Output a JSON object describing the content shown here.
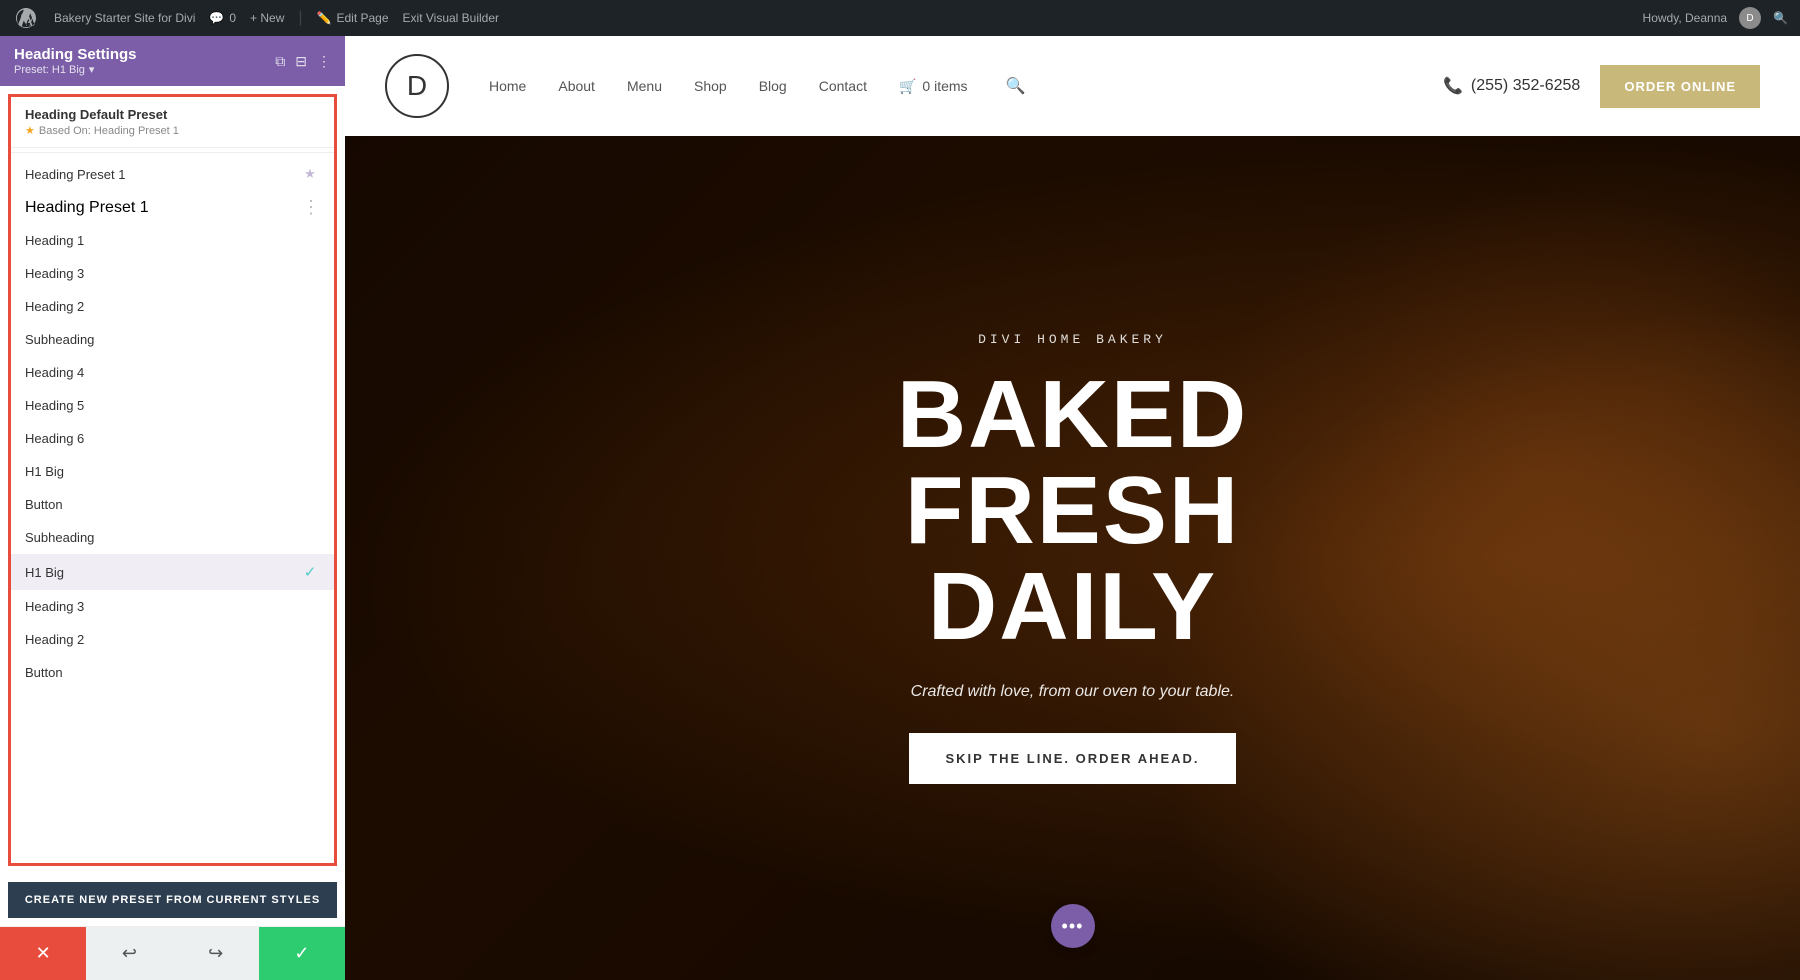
{
  "adminBar": {
    "wpLogoAlt": "WordPress",
    "siteName": "Bakery Starter Site for Divi",
    "commentCount": "0",
    "newLabel": "+ New",
    "editPageLabel": "Edit Page",
    "exitBuilderLabel": "Exit Visual Builder",
    "howdyText": "Howdy, Deanna",
    "searchIcon": "🔍"
  },
  "panelHeader": {
    "title": "Heading Settings",
    "preset": "Preset: H1 Big",
    "presetArrow": "▾",
    "duplicateIcon": "⧉",
    "splitIcon": "⊟",
    "moreIcon": "⋮"
  },
  "defaultPreset": {
    "name": "Heading Default Preset",
    "starIcon": "★",
    "basedOnLabel": "Based On: Heading Preset 1"
  },
  "presets": [
    {
      "label": "Heading Preset 1",
      "icon": "star",
      "active": false
    },
    {
      "label": "Heading Preset 1",
      "icon": "dots",
      "active": false
    },
    {
      "label": "Heading 1",
      "icon": "",
      "active": false
    },
    {
      "label": "Heading 3",
      "icon": "",
      "active": false
    },
    {
      "label": "Heading 2",
      "icon": "",
      "active": false
    },
    {
      "label": "Subheading",
      "icon": "",
      "active": false
    },
    {
      "label": "Heading 4",
      "icon": "",
      "active": false
    },
    {
      "label": "Heading 5",
      "icon": "",
      "active": false
    },
    {
      "label": "Heading 6",
      "icon": "",
      "active": false
    },
    {
      "label": "H1 Big",
      "icon": "",
      "active": false
    },
    {
      "label": "Button",
      "icon": "",
      "active": false
    },
    {
      "label": "Subheading",
      "icon": "",
      "active": false
    },
    {
      "label": "H1 Big",
      "icon": "check",
      "active": true
    },
    {
      "label": "Heading 3",
      "icon": "",
      "active": false
    },
    {
      "label": "Heading 2",
      "icon": "",
      "active": false
    },
    {
      "label": "Button",
      "icon": "",
      "active": false
    }
  ],
  "createButton": {
    "label": "CREATE NEW PRESET FROM CURRENT STYLES"
  },
  "bottomBar": {
    "cancelIcon": "✕",
    "undoIcon": "↩",
    "redoIcon": "↪",
    "confirmIcon": "✓"
  },
  "siteNav": {
    "logoText": "D",
    "items": [
      {
        "label": "Home"
      },
      {
        "label": "About"
      },
      {
        "label": "Menu"
      },
      {
        "label": "Shop"
      },
      {
        "label": "Blog"
      },
      {
        "label": "Contact"
      }
    ],
    "cartLabel": "0 items",
    "phoneIcon": "📞",
    "phoneNumber": "(255) 352-6258",
    "orderButtonLabel": "ORDER ONLINE"
  },
  "hero": {
    "subtitle": "DIVI HOME BAKERY",
    "titleLine1": "BAKED FRESH",
    "titleLine2": "DAILY",
    "description": "Crafted with love, from our oven to your table.",
    "ctaLabel": "SKIP THE LINE. ORDER AHEAD.",
    "floatingDotsIcon": "•••"
  }
}
